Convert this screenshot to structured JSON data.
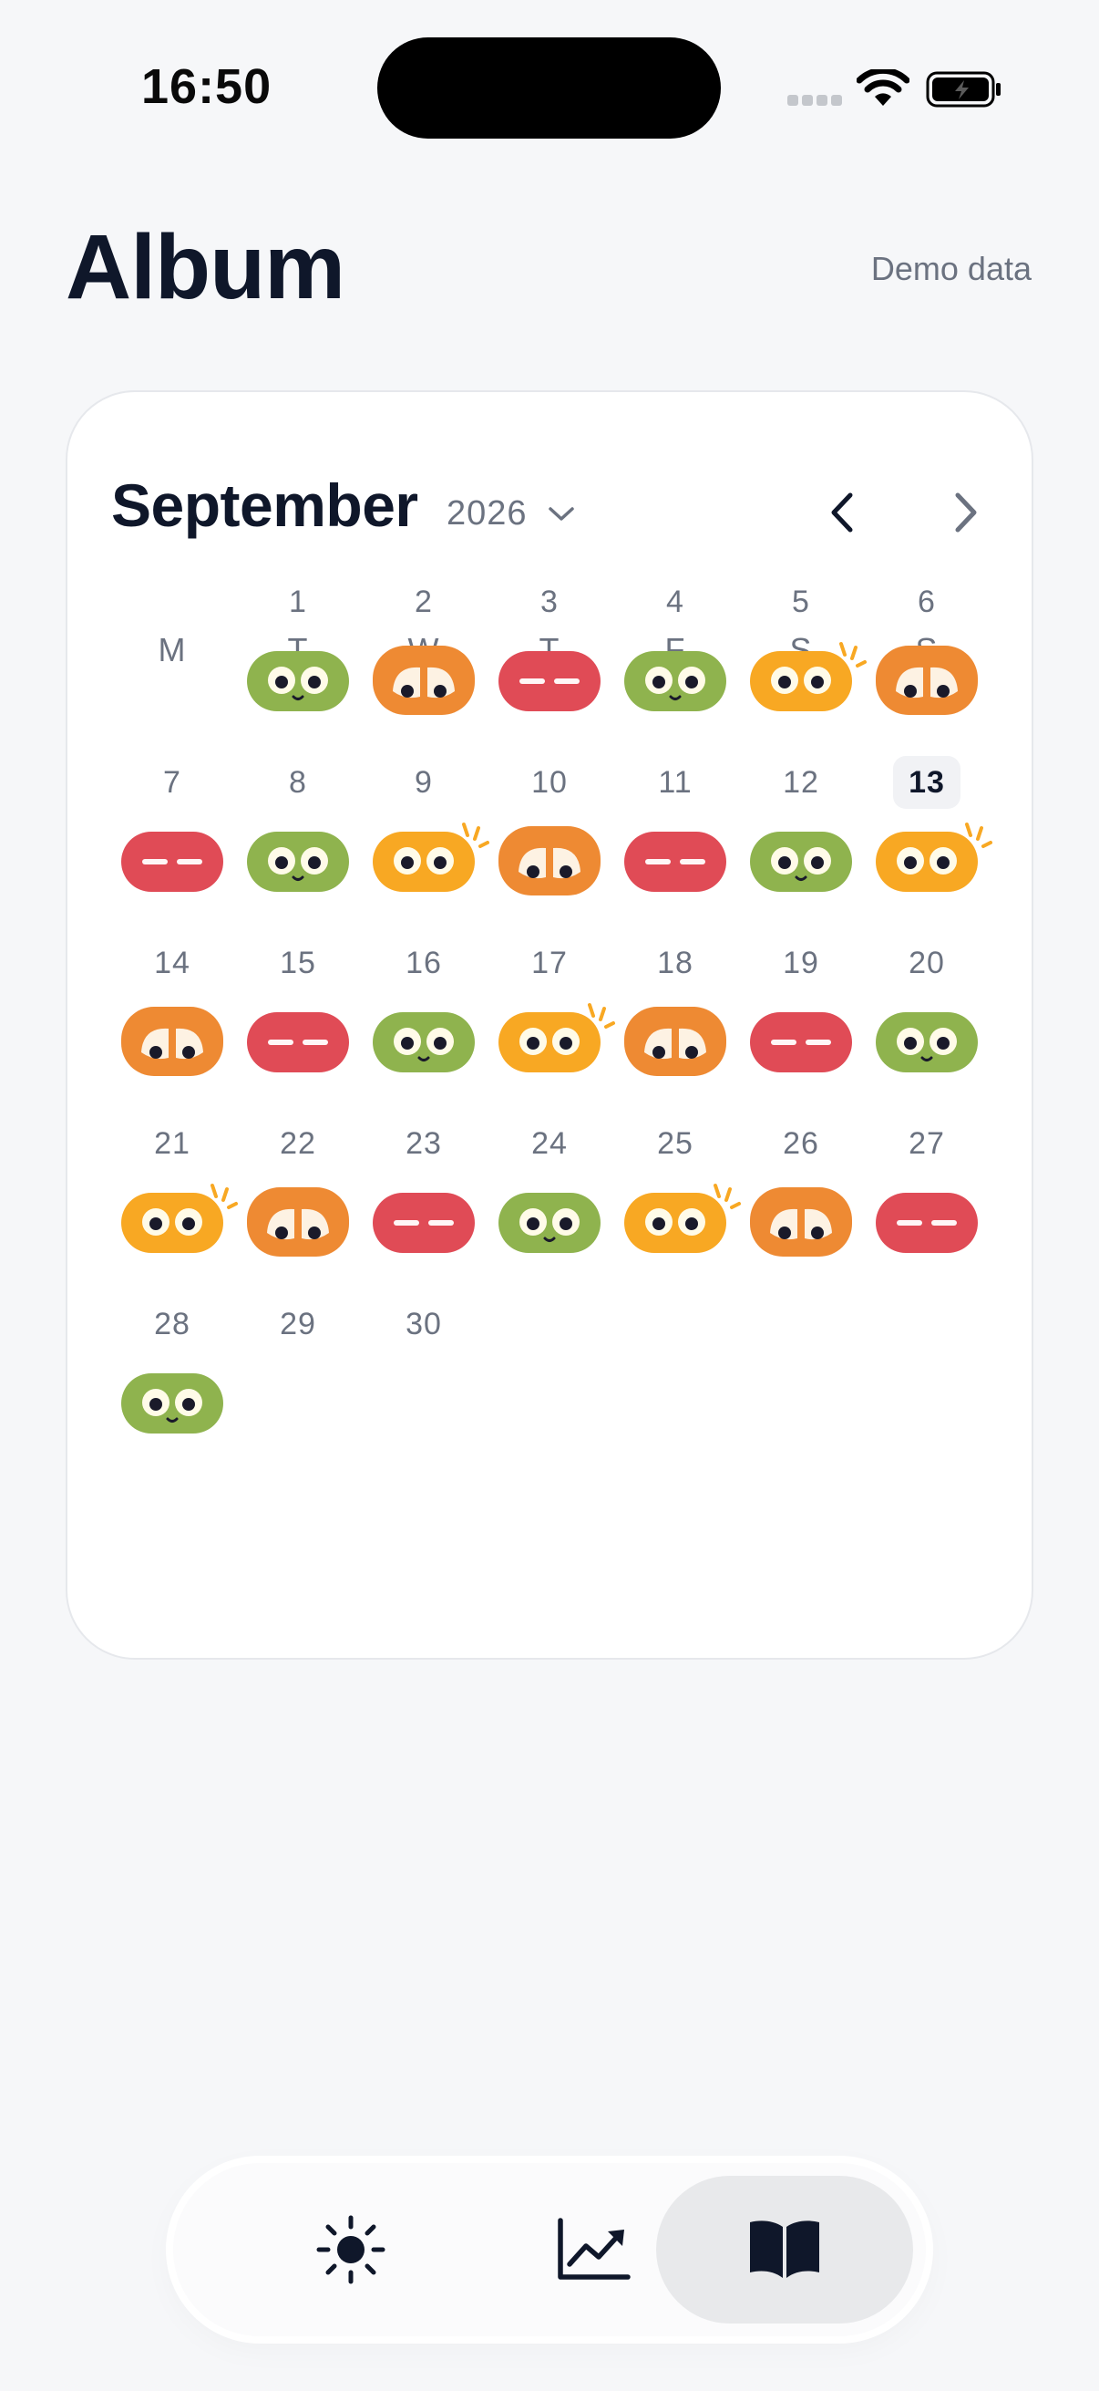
{
  "status_bar": {
    "time": "16:50"
  },
  "header": {
    "title": "Album",
    "demo_label": "Demo data"
  },
  "calendar": {
    "month": "September",
    "year": "2026",
    "weekdays": [
      "M",
      "T",
      "W",
      "T",
      "F",
      "S",
      "S"
    ],
    "today": "13",
    "weeks": [
      [
        null,
        {
          "d": "1",
          "mood": "green"
        },
        {
          "d": "2",
          "mood": "orange"
        },
        {
          "d": "3",
          "mood": "red"
        },
        {
          "d": "4",
          "mood": "green"
        },
        {
          "d": "5",
          "mood": "yellow"
        },
        {
          "d": "6",
          "mood": "orange"
        }
      ],
      [
        {
          "d": "7",
          "mood": "red"
        },
        {
          "d": "8",
          "mood": "green"
        },
        {
          "d": "9",
          "mood": "yellow"
        },
        {
          "d": "10",
          "mood": "orange"
        },
        {
          "d": "11",
          "mood": "red"
        },
        {
          "d": "12",
          "mood": "green"
        },
        {
          "d": "13",
          "mood": "yellow"
        }
      ],
      [
        {
          "d": "14",
          "mood": "orange"
        },
        {
          "d": "15",
          "mood": "red"
        },
        {
          "d": "16",
          "mood": "green"
        },
        {
          "d": "17",
          "mood": "yellow"
        },
        {
          "d": "18",
          "mood": "orange"
        },
        {
          "d": "19",
          "mood": "red"
        },
        {
          "d": "20",
          "mood": "green"
        }
      ],
      [
        {
          "d": "21",
          "mood": "yellow"
        },
        {
          "d": "22",
          "mood": "orange"
        },
        {
          "d": "23",
          "mood": "red"
        },
        {
          "d": "24",
          "mood": "green"
        },
        {
          "d": "25",
          "mood": "yellow"
        },
        {
          "d": "26",
          "mood": "orange"
        },
        {
          "d": "27",
          "mood": "red"
        }
      ],
      [
        {
          "d": "28",
          "mood": "green"
        },
        {
          "d": "29",
          "mood": null
        },
        {
          "d": "30",
          "mood": null
        },
        null,
        null,
        null,
        null
      ]
    ]
  },
  "mood_colors": {
    "green": "#8fb34e",
    "orange": "#ee8a33",
    "red": "#e04b56",
    "yellow": "#f8a823"
  },
  "tabs": [
    {
      "name": "today",
      "icon": "sun-icon",
      "active": false
    },
    {
      "name": "trends",
      "icon": "chart-line-icon",
      "active": false
    },
    {
      "name": "album",
      "icon": "book-open-icon",
      "active": true
    }
  ]
}
